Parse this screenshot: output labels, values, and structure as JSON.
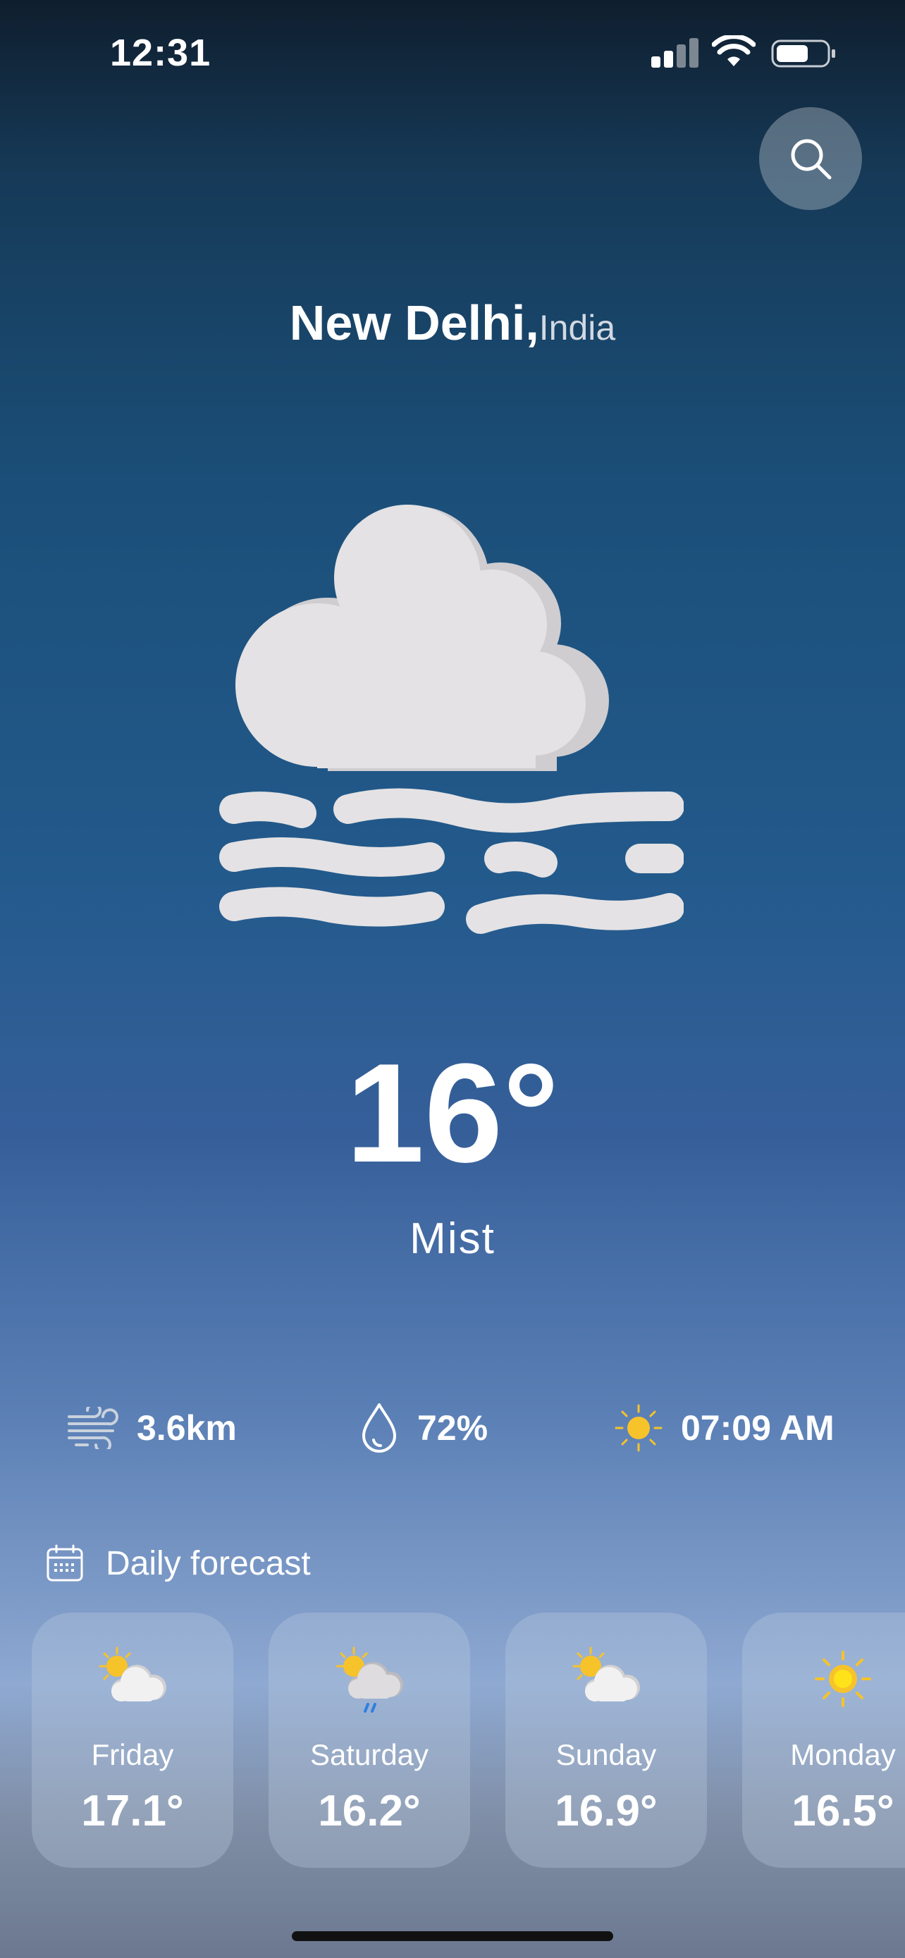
{
  "status_bar": {
    "time": "12:31"
  },
  "search": {
    "icon": "search-icon"
  },
  "location": {
    "city": "New Delhi,",
    "country": "India"
  },
  "current": {
    "icon": "mist-icon",
    "temperature": "16°",
    "condition": "Mist"
  },
  "stats": {
    "wind": "3.6km",
    "humidity": "72%",
    "sunrise": "07:09 AM"
  },
  "daily": {
    "header": "Daily forecast",
    "days": [
      {
        "day": "Friday",
        "temp": "17.1°",
        "icon": "partly-cloudy-icon"
      },
      {
        "day": "Saturday",
        "temp": "16.2°",
        "icon": "partly-cloudy-rain-icon"
      },
      {
        "day": "Sunday",
        "temp": "16.9°",
        "icon": "partly-cloudy-icon"
      },
      {
        "day": "Monday",
        "temp": "16.5°",
        "icon": "sun-icon"
      }
    ]
  },
  "colors": {
    "sun": "#f7c32a",
    "cloud": "#e4e2e4",
    "rain": "#2f7fe0"
  }
}
